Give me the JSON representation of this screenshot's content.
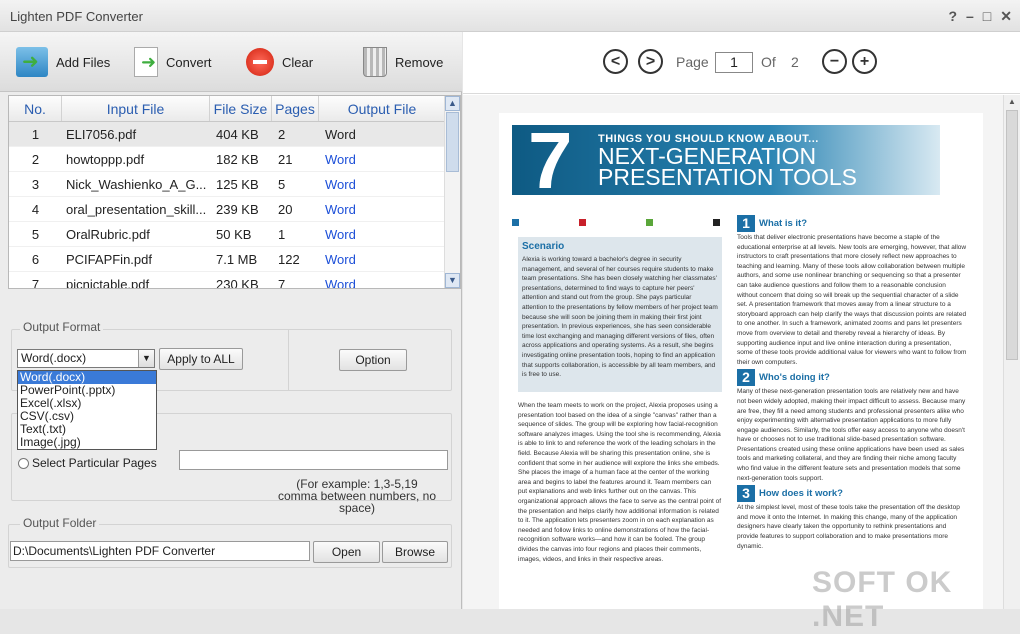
{
  "window": {
    "title": "Lighten PDF Converter",
    "buttons": [
      "?",
      "–",
      "□",
      "✕"
    ]
  },
  "toolbar": {
    "add_label": "Add Files",
    "convert_label": "Convert",
    "clear_label": "Clear",
    "remove_label": "Remove"
  },
  "grid": {
    "headers": [
      "No.",
      "Input File",
      "File Size",
      "Pages",
      "Output File"
    ],
    "rows": [
      {
        "no": "1",
        "file": "ELI7056.pdf",
        "size": "404 KB",
        "pages": "2",
        "out": "Word"
      },
      {
        "no": "2",
        "file": "howtoppp.pdf",
        "size": "182 KB",
        "pages": "21",
        "out": "Word"
      },
      {
        "no": "3",
        "file": "Nick_Washienko_A_G...",
        "size": "125 KB",
        "pages": "5",
        "out": "Word"
      },
      {
        "no": "4",
        "file": "oral_presentation_skill...",
        "size": "239 KB",
        "pages": "20",
        "out": "Word"
      },
      {
        "no": "5",
        "file": "OralRubric.pdf",
        "size": "50 KB",
        "pages": "1",
        "out": "Word"
      },
      {
        "no": "6",
        "file": "PCIFAPFin.pdf",
        "size": "7.1 MB",
        "pages": "122",
        "out": "Word"
      },
      {
        "no": "7",
        "file": "picnictable.pdf",
        "size": "230 KB",
        "pages": "7",
        "out": "Word"
      }
    ]
  },
  "output_format": {
    "legend": "Output Format",
    "selected": "Word(.docx)",
    "options": [
      "Word(.docx)",
      "PowerPoint(.pptx)",
      "Excel(.xlsx)",
      "CSV(.csv)",
      "Text(.txt)",
      "Image(.jpg)"
    ],
    "apply_label": "Apply to ALL",
    "option_label": "Option"
  },
  "pages": {
    "particular_label": "Select Particular Pages",
    "hint_line1": "(For example: 1,3-5,19",
    "hint_line2": "comma between numbers, no space)"
  },
  "output_folder": {
    "legend": "Output Folder",
    "path": "D:\\Documents\\Lighten PDF Converter",
    "open_label": "Open",
    "browse_label": "Browse"
  },
  "viewer": {
    "prev_icon": "<",
    "next_icon": ">",
    "page_label": "Page",
    "page_value": "1",
    "of_label": "Of",
    "total": "2",
    "zoom_out_icon": "−",
    "zoom_in_icon": "+"
  },
  "document": {
    "big_number": "7",
    "heading1": "THINGS YOU SHOULD KNOW ABOUT...",
    "heading2": "NEXT-GENERATION",
    "heading3": "PRESENTATION TOOLS",
    "scenario_title": "Scenario",
    "scenario_text": "Alexia is working toward a bachelor's degree in security management, and several of her courses require students to make team presentations. She has been closely watching her classmates' presentations, determined to find ways to capture her peers' attention and stand out from the group. She pays particular attention to the presentations by fellow members of her project team because she will soon be joining them in making their first joint presentation. In previous experiences, she has seen considerable time lost exchanging and managing different versions of files, often across applications and operating systems. As a result, she begins investigating online presentation tools, hoping to find an application that supports collaboration, is accessible by all team members, and is free to use.",
    "body_text": "When the team meets to work on the project, Alexia proposes using a presentation tool based on the idea of a single \"canvas\" rather than a sequence of slides. The group will be exploring how facial-recognition software analyzes images. Using the tool she is recommending, Alexia is able to link to and reference the work of the leading scholars in the field. Because Alexia will be sharing this presentation online, she is confident that some in her audience will explore the links she embeds. She places the image of a human face at the center of the working area and begins to label the features around it. Team members can put explanations and web links further out on the canvas. This organizational approach allows the face to serve as the central point of the presentation and helps clarify how additional information is related to it. The application lets presenters zoom in on each explanation as needed and follow links to online demonstrations of how the facial-recognition software works—and how it can be fooled. The group divides the canvas into four regions and places their comments, images, videos, and links in their respective areas.",
    "s1_title": "What is it?",
    "s1_text": "Tools that deliver electronic presentations have become a staple of the educational enterprise at all levels. New tools are emerging, however, that allow instructors to craft presentations that more closely reflect new approaches to teaching and learning. Many of these tools allow collaboration between multiple authors, and some use nonlinear branching or sequencing so that a presenter can take audience questions and follow them to a reasonable conclusion without concern that doing so will break up the sequential character of a slide set. A presentation framework that moves away from a linear structure to a storyboard approach can help clarify the ways that discussion points are related to one another. In such a framework, animated zooms and pans let presenters move from overview to detail and thereby reveal a hierarchy of ideas. By supporting audience input and live online interaction during a presentation, some of these tools provide additional value for viewers who want to follow from their own computers.",
    "s2_title": "Who's doing it?",
    "s2_text": "Many of these next-generation presentation tools are relatively new and have not been widely adopted, making their impact difficult to assess. Because many are free, they fill a need among students and professional presenters alike who enjoy experimenting with alternative presentation applications to more fully engage audiences. Similarly, the tools offer easy access to anyone who doesn't have or chooses not to use traditional slide-based presentation software. Presentations created using these online applications have been used as sales tools and marketing collateral, and they are finding their niche among faculty who find value in the different feature sets and presentation models that some next-generation tools support.",
    "s3_title": "How does it work?",
    "s3_text": "At the simplest level, most of these tools take the presentation off the desktop and move it onto the Internet. In making this change, many of the application designers have clearly taken the opportunity to rethink presentations and provide features to support collaboration and to make presentations more dynamic."
  },
  "watermark": "SOFT OK .NET",
  "colors": {
    "accent": "#1b6fa6",
    "link": "#1c4fd8",
    "selection": "#3a7ad8"
  }
}
